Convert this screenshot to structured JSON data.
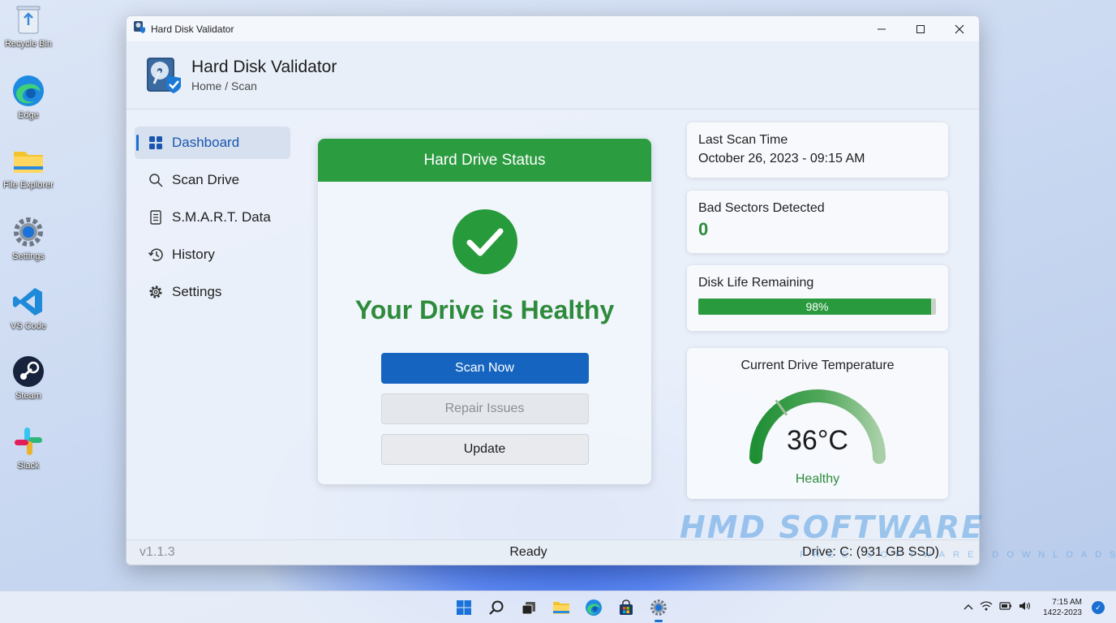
{
  "desktop": {
    "icons": [
      {
        "label": "Recycle Bin",
        "icon": "recycle-bin-icon"
      },
      {
        "label": "Edge",
        "icon": "edge-icon"
      },
      {
        "label": "File Explorer",
        "icon": "folder-icon"
      },
      {
        "label": "Settings",
        "icon": "gear-icon"
      },
      {
        "label": "VS Code",
        "icon": "vscode-icon"
      },
      {
        "label": "Steam",
        "icon": "steam-icon"
      },
      {
        "label": "Slack",
        "icon": "slack-icon"
      }
    ]
  },
  "window": {
    "title": "Hard Disk Validator",
    "controls": [
      "minimize",
      "maximize",
      "close"
    ]
  },
  "header": {
    "app_name": "Hard Disk Validator",
    "breadcrumb": "Home / Scan"
  },
  "sidebar": {
    "items": [
      {
        "label": "Dashboard",
        "icon": "dashboard-icon",
        "active": true
      },
      {
        "label": "Scan Drive",
        "icon": "search-icon",
        "active": false
      },
      {
        "label": "S.M.A.R.T. Data",
        "icon": "document-icon",
        "active": false
      },
      {
        "label": "History",
        "icon": "history-icon",
        "active": false
      },
      {
        "label": "Settings",
        "icon": "gear-icon",
        "active": false
      }
    ]
  },
  "status_card": {
    "header": "Hard Drive Status",
    "message": "Your Drive is Healthy",
    "buttons": {
      "scan": "Scan Now",
      "repair": "Repair Issues",
      "update": "Update"
    }
  },
  "info": {
    "last_scan": {
      "label": "Last Scan Time",
      "value": "October 26, 2023 - 09:15 AM"
    },
    "bad_sectors": {
      "label": "Bad Sectors Detected",
      "value": "0"
    },
    "disk_life": {
      "label": "Disk Life Remaining",
      "value": "98%",
      "percent": 98
    },
    "temperature": {
      "label": "Current Drive Temperature",
      "value": "36°C",
      "status": "Healthy",
      "gauge_fraction": 0.3
    }
  },
  "statusbar": {
    "version": "v1.1.3",
    "status": "Ready",
    "drive": "Drive: C: (931 GB SSD)"
  },
  "watermark": {
    "main": "HMD SOFTWARE",
    "sub": "FREE SOFTWARE DOWNLOADS"
  },
  "taskbar": {
    "apps": [
      "start-icon",
      "search-icon",
      "task-view-icon",
      "file-explorer-icon",
      "edge-icon",
      "store-icon",
      "settings-icon"
    ],
    "time": "7:15 AM",
    "date": "1422-2023"
  },
  "colors": {
    "accent_green": "#2c9c41",
    "accent_blue": "#1565c0",
    "healthy_text": "#2e8b3b"
  }
}
